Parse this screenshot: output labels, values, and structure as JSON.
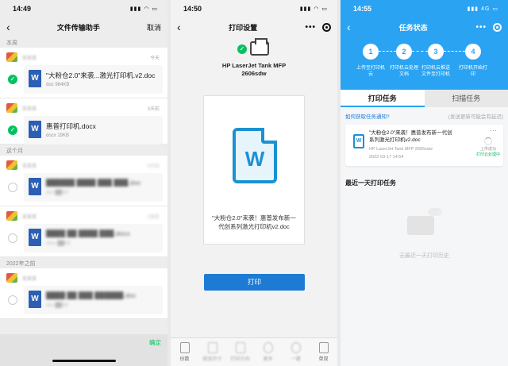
{
  "panel1": {
    "status": {
      "time": "14:49",
      "indicators": "▮▮▮ ◠ ▭"
    },
    "nav": {
      "back": "‹",
      "title": "文件传输助手",
      "action": "取消"
    },
    "sections": [
      "本周",
      "这个月",
      "2022年之前"
    ],
    "cards": [
      {
        "sender": "张某某",
        "date": "今天",
        "filename": "\"大粉仓2.0\"来袭...激光打印机.v2.doc",
        "size": "doc 984KB",
        "checked": true,
        "blur": false
      },
      {
        "sender": "张某某",
        "date": "3天前",
        "filename": "惠普打印机.docx",
        "size": "docx 19KB",
        "checked": true,
        "blur": false
      },
      {
        "sender": "张某某",
        "date": "9天前",
        "filename": "██████ ████ ███ ███.doc",
        "size": "doc ██KB",
        "checked": false,
        "blur": true
      },
      {
        "sender": "张某某",
        "date": "2周前",
        "filename": "████ ██ ████ ███.docx",
        "size": "docx ██KB",
        "checked": false,
        "blur": true
      },
      {
        "sender": "张某某",
        "date": "",
        "filename": "████ ██ ███ ██████.doc",
        "size": "doc ██KB",
        "checked": false,
        "blur": true
      }
    ],
    "confirm": "确定"
  },
  "panel2": {
    "status": {
      "time": "14:50",
      "indicators": "▮▮▮ ◠ ▭"
    },
    "nav": {
      "back": "‹",
      "title": "打印设置"
    },
    "check": "✓",
    "printer_name": "HP LaserJet Tank MFP 2606sdw",
    "doc_letter": "W",
    "doc_title": "\"大粉仓2.0\"来袭！惠普发布新一代创系列激光打印机v2.doc",
    "print_button": "打印",
    "tabs": [
      {
        "label": "份数",
        "blur": false
      },
      {
        "label": "纸张尺寸",
        "blur": true
      },
      {
        "label": "打印方向",
        "blur": true
      },
      {
        "label": "更多",
        "blur": true
      },
      {
        "label": "一键",
        "blur": true
      },
      {
        "label": "单双",
        "blur": false
      }
    ]
  },
  "panel3": {
    "status": {
      "time": "14:55",
      "indicators": "▮▮▮ 4G ▭"
    },
    "nav": {
      "back": "‹",
      "title": "任务状态"
    },
    "steps": [
      {
        "num": "1",
        "label": "上传至打印机云"
      },
      {
        "num": "2",
        "label": "打印机云处理文档"
      },
      {
        "num": "3",
        "label": "打印机云推送文件至打印机"
      },
      {
        "num": "4",
        "label": "打印机开始打印"
      }
    ],
    "tabs": {
      "active": "打印任务",
      "inactive": "扫描任务"
    },
    "help": {
      "left": "如何获取任务通知?",
      "right": "(发送更新可能会有延迟)"
    },
    "job": {
      "doc_letter": "W",
      "title": "\"大粉仓2.0\"来袭！惠普发布新一代创系列激光打印机v2.doc",
      "printer": "HP LaserJet Tank MFP 2606sdw",
      "time": "2022-03-17 14:54",
      "state_top": "上传成功",
      "state": "打印云处理中",
      "more": "···"
    },
    "recent_title": "最近一天打印任务",
    "empty_text": "无最近一天打印历史",
    "empty_bubble": "···"
  }
}
